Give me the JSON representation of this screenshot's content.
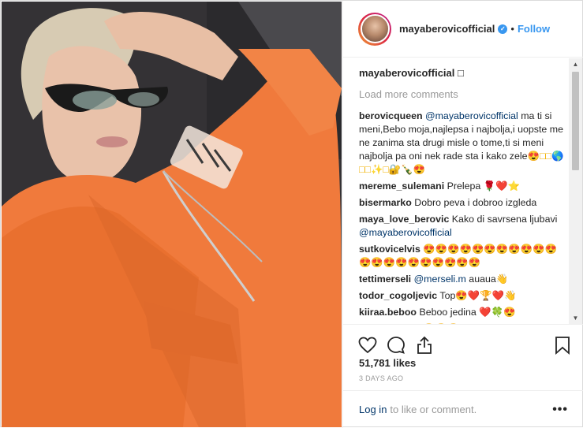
{
  "post": {
    "username": "mayaberovicofficial",
    "verified_symbol": "✓",
    "dot": "•",
    "follow_label": "Follow",
    "caption_text": "□",
    "load_more_label": "Load more comments",
    "comments": [
      {
        "user": "berovicqueen",
        "mention": "@mayaberovicofficial",
        "text": " ma ti si meni,Bebo moja,najlepsa i najbolja,i uopste me ne zanima sta drugi misle o tome,ti si meni najbolja pa oni nek rade sta i kako zele",
        "emoji": "😍□□🌎□□✨□🔐🍾😍"
      },
      {
        "user": "mereme_sulemani",
        "text": "Prelepa ",
        "emoji": "🌹❤️⭐"
      },
      {
        "user": "bisermarko",
        "text": "Dobro peva i dobroo izgleda",
        "emoji": ""
      },
      {
        "user": "maya_love_berovic",
        "text": "Kako di savrsena ljubavi ",
        "mention": "@mayaberovicofficial",
        "emoji": ""
      },
      {
        "user": "sutkovicelvis",
        "text": " ",
        "emoji": "😍😍😍😍😍😍😍😍😍😍😍😍😍😍😍😍😍😍😍😍😍"
      },
      {
        "user": "tettimerseli",
        "mention": "@merseli.m",
        "text": " auaua",
        "emoji": "👋"
      },
      {
        "user": "todor_cogoljevic",
        "text": "Top",
        "emoji": "😍❤️🏆❤️👋"
      },
      {
        "user": "kiiraa.beboo",
        "text": "Beboo jedina ",
        "emoji": "❤️🍀😍"
      },
      {
        "user": "laraxokmazic",
        "text": " ",
        "emoji": "😍😍😍"
      }
    ],
    "likes_label": "51,781 likes",
    "date_label": "3 days ago",
    "login_label": "Log in",
    "login_suffix": "to like or comment.",
    "more_label": "•••"
  },
  "icons": [
    "heart-icon",
    "comment-icon",
    "share-icon",
    "bookmark-icon"
  ],
  "colors": {
    "accent": "#3897f0",
    "jacket": "#f07a3c",
    "border": "#dbdbdb",
    "muted": "#999999"
  }
}
